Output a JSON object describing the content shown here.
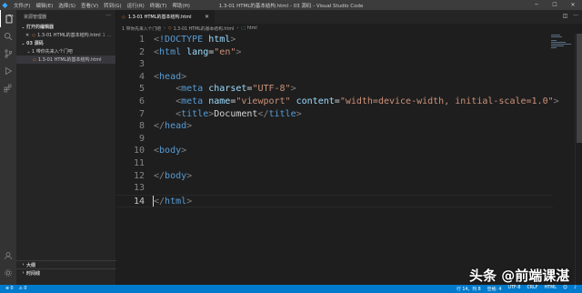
{
  "titlebar": {
    "menu": [
      "文件(F)",
      "编辑(E)",
      "选择(S)",
      "查看(V)",
      "转到(G)",
      "运行(R)",
      "终端(T)",
      "帮助(H)"
    ],
    "window_title": "1.3-01 HTML的基本结构.html - 03 源码 - Visual Studio Code"
  },
  "activity_icons": [
    "files-icon",
    "search-icon",
    "source-control-icon",
    "run-debug-icon",
    "extensions-icon",
    "manage-gear-icon",
    "accounts-icon"
  ],
  "sidebar": {
    "title": "资源管理器",
    "open_editors_header": "打开的编辑器",
    "open_editors": [
      {
        "name": "1.3-01 HTML的基本结构.html",
        "hint": "1 ..."
      }
    ],
    "folder_header": "03 源码",
    "folder_items": [
      {
        "name": "1 带你先来入个门吧"
      },
      {
        "name": "1.3-01 HTML的基本结构.html"
      }
    ],
    "outline_header": "大纲",
    "timeline_header": "时间线"
  },
  "tabs": [
    {
      "label": "1.3-01 HTML的基本结构.html"
    }
  ],
  "breadcrumb": [
    "1 带你先来入个门吧",
    "1.3-01 HTML的基本结构.html",
    "html"
  ],
  "editor": {
    "lines": [
      "<!DOCTYPE html>",
      "<html lang=\"en\">",
      "",
      "<head>",
      "    <meta charset=\"UTF-8\">",
      "    <meta name=\"viewport\" content=\"width=device-width, initial-scale=1.0\">",
      "    <title>Document</title>",
      "</head>",
      "",
      "<body>",
      "",
      "</body>",
      "",
      "</html>"
    ],
    "current_line": 14
  },
  "status": {
    "left": [
      "⊗ 0",
      "⚠ 0"
    ],
    "right": [
      "行 14，列 8",
      "空格: 4",
      "UTF-8",
      "CRLF",
      "HTML"
    ]
  },
  "watermark": "头条 @前端课湛",
  "colors": {
    "accent": "#007acc",
    "tag": "#569cd6",
    "attr": "#9cdcfe",
    "string": "#ce9178"
  }
}
